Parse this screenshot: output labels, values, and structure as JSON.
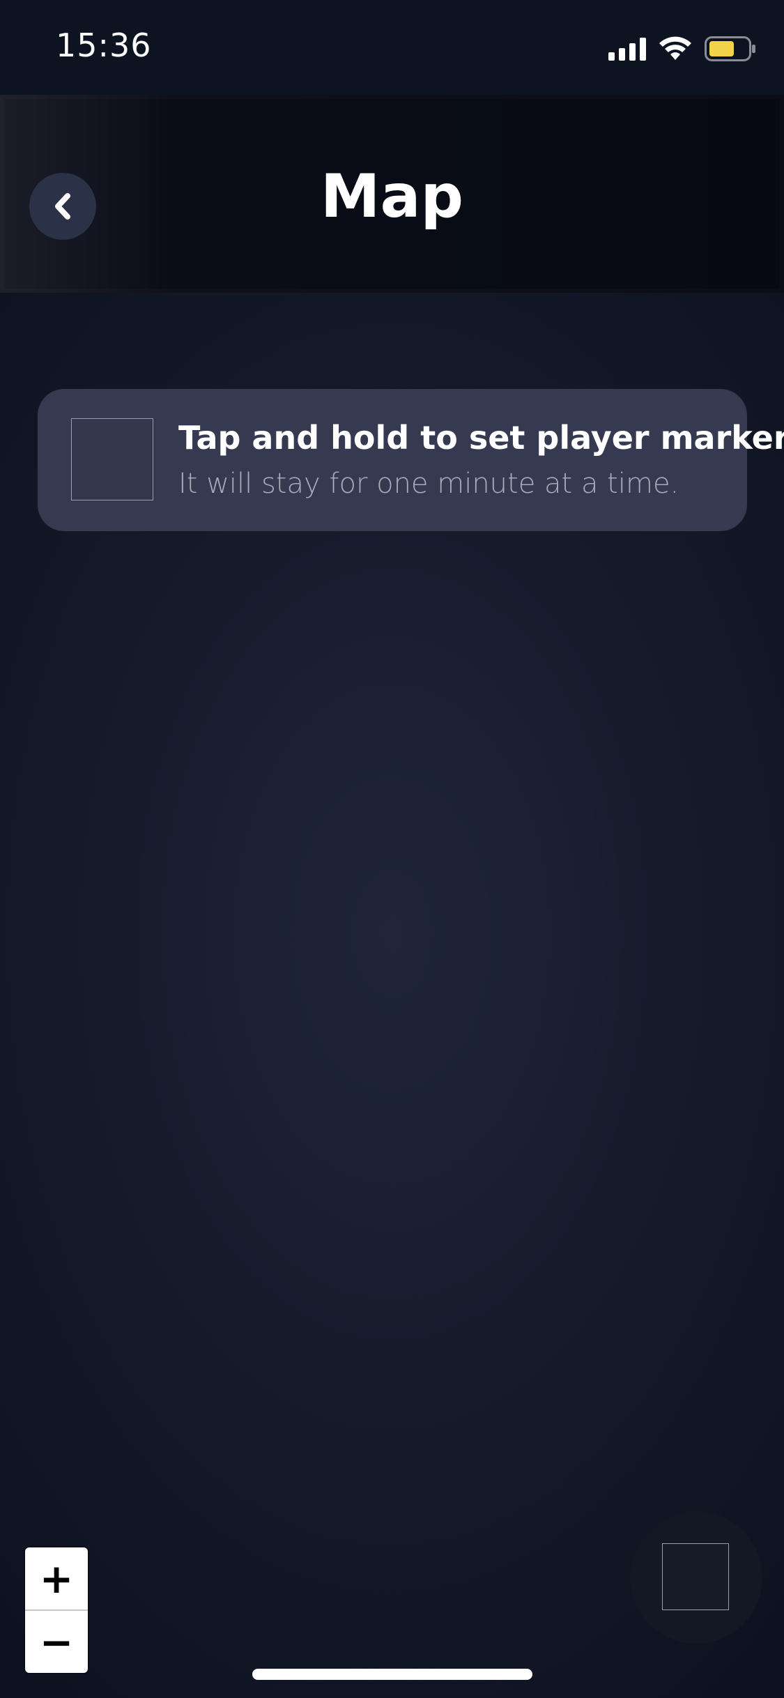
{
  "status_bar": {
    "time": "15:36",
    "icons": [
      "signal-icon",
      "wifi-icon",
      "battery-icon"
    ],
    "battery_color": "#f3d34a"
  },
  "header": {
    "title": "Map",
    "back_icon": "chevron-left-icon"
  },
  "hint": {
    "title": "Tap and hold to set player marker.",
    "subtitle": "It will stay for one minute at a time."
  },
  "zoom": {
    "in_label": "+",
    "out_label": "−"
  },
  "colors": {
    "background": "#151a2a",
    "header": "#070a13",
    "card": "#363a50",
    "back_button": "#2b3146"
  }
}
